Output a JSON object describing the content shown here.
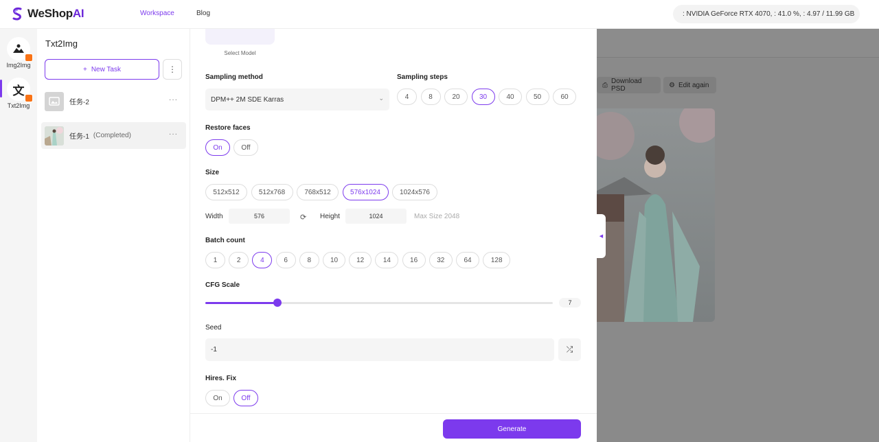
{
  "header": {
    "logo_text": "WeShop",
    "logo_ai": "AI",
    "nav": {
      "workspace": "Workspace",
      "blog": "Blog"
    },
    "gpu_status": ": NVIDIA GeForce RTX 4070, : 41.0 %, : 4.97 / 11.99 GB"
  },
  "rail": {
    "items": [
      {
        "label": "Img2Img",
        "icon": "image-icon"
      },
      {
        "label": "Txt2Img",
        "icon": "text-icon"
      }
    ]
  },
  "tasks": {
    "title": "Txt2Img",
    "new_task_label": "New Task",
    "items": [
      {
        "name": "任务-2",
        "status": ""
      },
      {
        "name": "任务-1",
        "status": "(Completed)"
      }
    ]
  },
  "form": {
    "model_label": "Select Model",
    "sampling_method": {
      "label": "Sampling method",
      "value": "DPM++ 2M SDE Karras"
    },
    "sampling_steps": {
      "label": "Sampling steps",
      "options": [
        "4",
        "8",
        "20",
        "30",
        "40",
        "50",
        "60"
      ],
      "selected": "30"
    },
    "restore_faces": {
      "label": "Restore faces",
      "options": [
        "On",
        "Off"
      ],
      "selected": "On"
    },
    "size": {
      "label": "Size",
      "options": [
        "512x512",
        "512x768",
        "768x512",
        "576x1024",
        "1024x576"
      ],
      "selected": "576x1024",
      "width_label": "Width",
      "width_value": "576",
      "height_label": "Height",
      "height_value": "1024",
      "max_size": "Max Size 2048"
    },
    "batch_count": {
      "label": "Batch count",
      "options": [
        "1",
        "2",
        "4",
        "6",
        "8",
        "10",
        "12",
        "14",
        "16",
        "32",
        "64",
        "128"
      ],
      "selected": "4"
    },
    "cfg_scale": {
      "label": "CFG Scale",
      "value": "7",
      "fraction": 0.207
    },
    "seed": {
      "label": "Seed",
      "value": "-1"
    },
    "hires_fix": {
      "label": "Hires. Fix",
      "options": [
        "On",
        "Off"
      ],
      "selected": "Off"
    },
    "generate_label": "Generate"
  },
  "preview": {
    "download_psd": "Download PSD",
    "edit_again": "Edit again"
  },
  "colors": {
    "accent": "#7c3aed",
    "badge": "#f97316"
  }
}
